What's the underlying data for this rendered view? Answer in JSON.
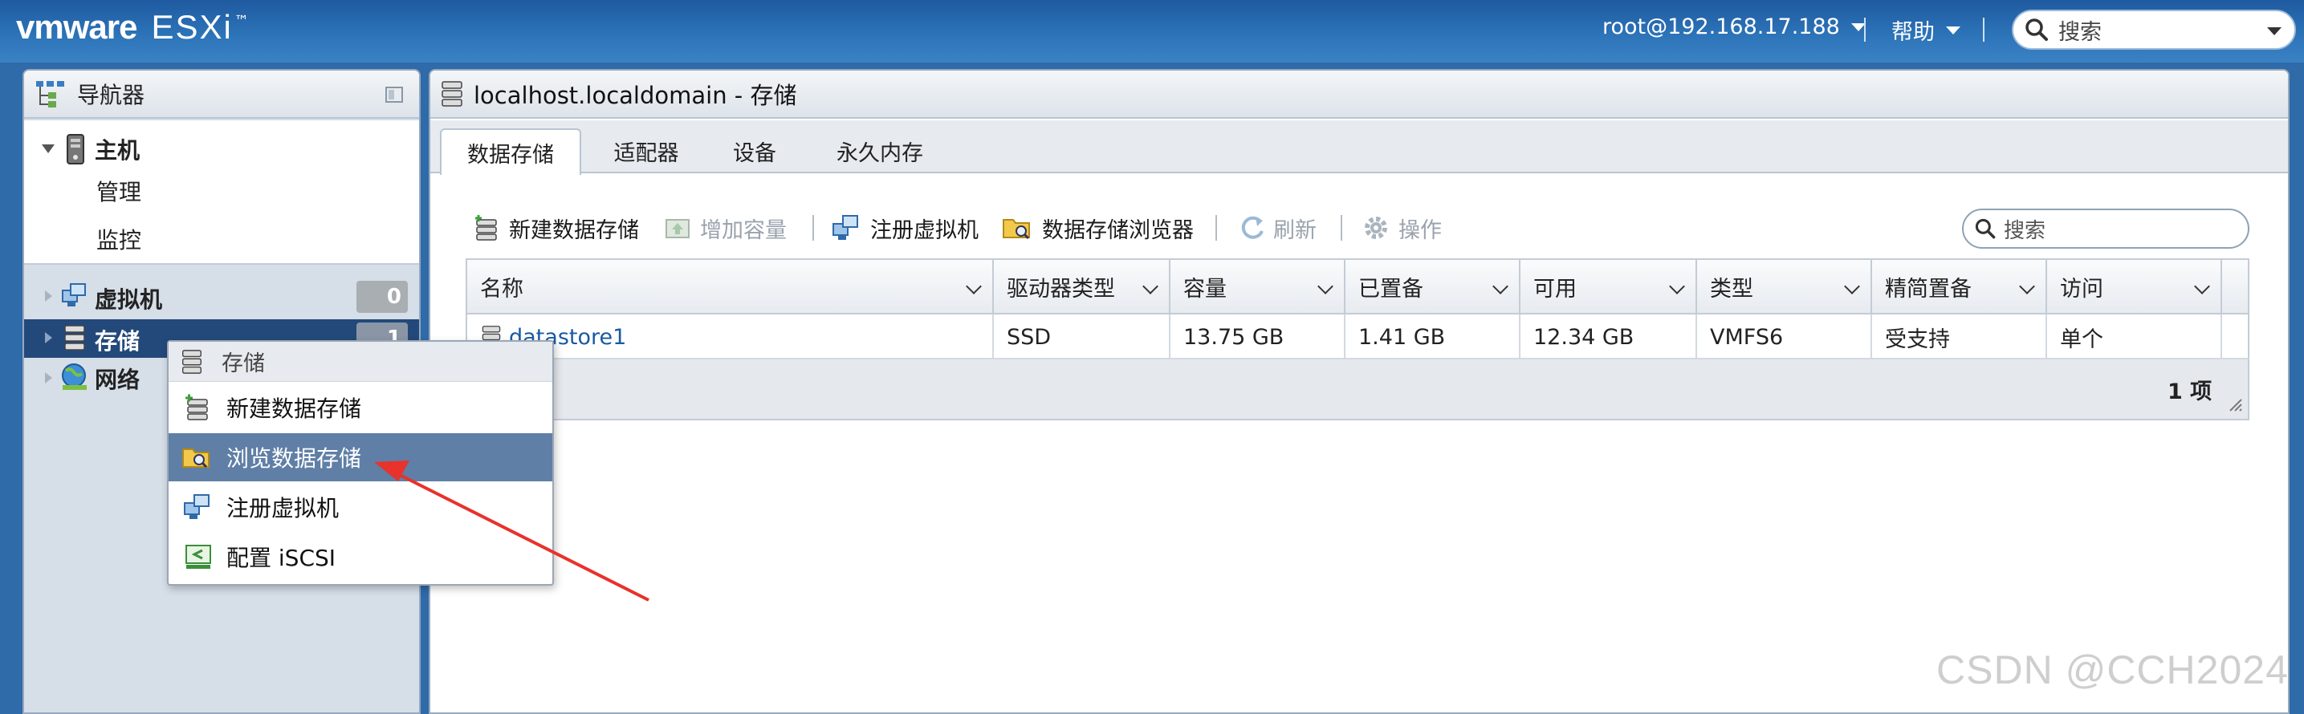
{
  "brand": {
    "vm": "vmware",
    "product": "ESXi",
    "tm": "™"
  },
  "topbar": {
    "user": "root@192.168.17.188",
    "help": "帮助",
    "search_placeholder": "搜索"
  },
  "navigator": {
    "title": "导航器",
    "host": {
      "label": "主机",
      "children": [
        "管理",
        "监控"
      ]
    },
    "items": [
      {
        "label": "虚拟机",
        "badge": "0"
      },
      {
        "label": "存储",
        "badge": "1"
      },
      {
        "label": "网络",
        "badge": ""
      }
    ]
  },
  "main": {
    "title": "localhost.localdomain - 存储",
    "tabs": [
      "数据存储",
      "适配器",
      "设备",
      "永久内存"
    ],
    "active_tab": 0,
    "toolbar": {
      "new_datastore": "新建数据存储",
      "increase_capacity": "增加容量",
      "register_vm": "注册虚拟机",
      "datastore_browser": "数据存储浏览器",
      "refresh": "刷新",
      "actions": "操作",
      "search_placeholder": "搜索"
    },
    "table": {
      "columns": [
        "名称",
        "驱动器类型",
        "容量",
        "已置备",
        "可用",
        "类型",
        "精简置备",
        "访问"
      ],
      "rows": [
        [
          "datastore1",
          "SSD",
          "13.75 GB",
          "1.41 GB",
          "12.34 GB",
          "VMFS6",
          "受支持",
          "单个"
        ]
      ],
      "count": "1 项"
    }
  },
  "context_menu": {
    "title": "存储",
    "items": [
      "新建数据存储",
      "浏览数据存储",
      "注册虚拟机",
      "配置 iSCSI"
    ],
    "highlighted": 1
  },
  "watermark": "CSDN @CCH2024",
  "colors": {
    "accent": "#2c73b8",
    "selection": "#23497a",
    "menu_highlight": "#5f7fa6",
    "arrow": "#e8322c"
  }
}
